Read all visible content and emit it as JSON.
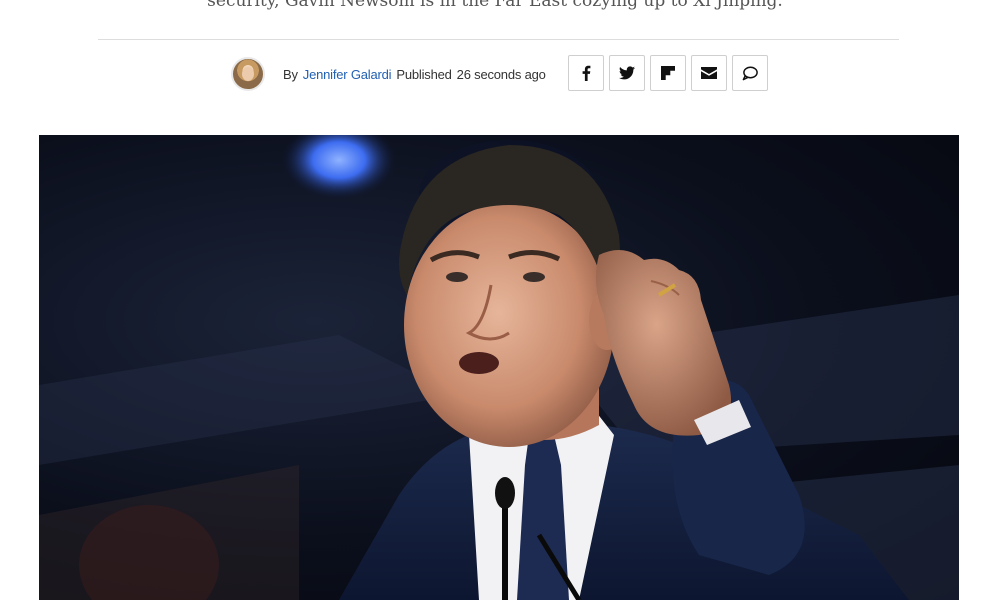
{
  "article": {
    "subtitle": "security, Gavin Newsom is in the Far East cozying up to Xi Jinping."
  },
  "byline": {
    "by_label": "By",
    "author": "Jennifer Galardi",
    "published_label": "Published",
    "time_ago": "26 seconds ago"
  },
  "share": {
    "buttons": [
      "facebook-icon",
      "twitter-icon",
      "flipboard-icon",
      "email-icon",
      "comment-icon"
    ]
  },
  "colors": {
    "author_link": "#2260b3",
    "text": "#333333",
    "border": "#cfcfcf"
  }
}
